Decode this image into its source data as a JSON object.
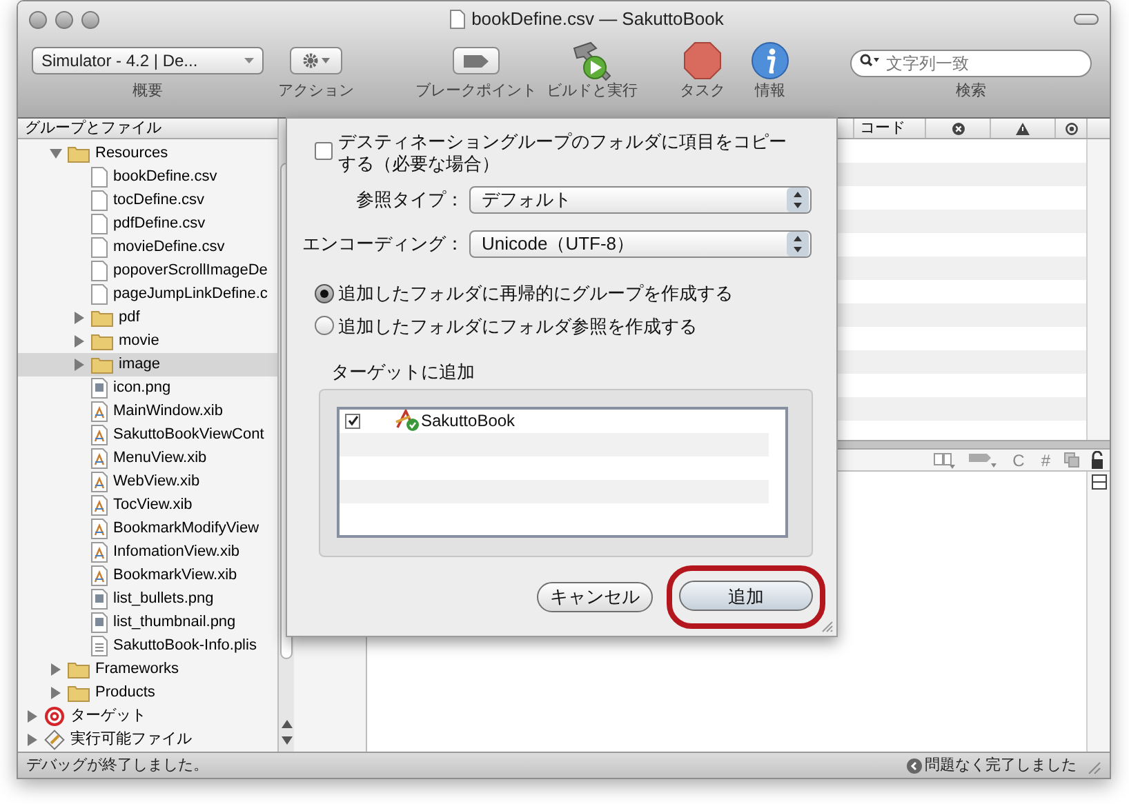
{
  "window": {
    "title": "bookDefine.csv — SakuttoBook"
  },
  "toolbar": {
    "scheme": {
      "value": "Simulator - 4.2 | De...",
      "label": "概要"
    },
    "items": [
      {
        "kind": "action",
        "label": "アクション"
      },
      {
        "kind": "breakpoints",
        "label": "ブレークポイント"
      },
      {
        "kind": "build",
        "label": "ビルドと実行"
      },
      {
        "kind": "tasks",
        "label": "タスク"
      },
      {
        "kind": "info",
        "label": "情報"
      }
    ],
    "search": {
      "placeholder": "文字列一致",
      "label": "検索"
    }
  },
  "sidebar": {
    "header": "グループとファイル",
    "project_items": [
      {
        "label": "Resources",
        "kind": "folder",
        "expanded": true,
        "selected": false,
        "children": [
          {
            "label": "bookDefine.csv",
            "kind": "file",
            "selected": false
          },
          {
            "label": "tocDefine.csv",
            "kind": "file",
            "selected": false
          },
          {
            "label": "pdfDefine.csv",
            "kind": "file",
            "selected": false
          },
          {
            "label": "movieDefine.csv",
            "kind": "file",
            "selected": false
          },
          {
            "label": "popoverScrollImageDe",
            "kind": "file",
            "selected": false
          },
          {
            "label": "pageJumpLinkDefine.c",
            "kind": "file",
            "selected": false
          },
          {
            "label": "pdf",
            "kind": "folder",
            "expanded": false,
            "selected": false
          },
          {
            "label": "movie",
            "kind": "folder",
            "expanded": false,
            "selected": false
          },
          {
            "label": "image",
            "kind": "folder",
            "expanded": false,
            "selected": true
          },
          {
            "label": "icon.png",
            "kind": "image",
            "selected": false
          },
          {
            "label": "MainWindow.xib",
            "kind": "xib",
            "selected": false
          },
          {
            "label": "SakuttoBookViewCont",
            "kind": "xib",
            "selected": false
          },
          {
            "label": "MenuView.xib",
            "kind": "xib",
            "selected": false
          },
          {
            "label": "WebView.xib",
            "kind": "xib",
            "selected": false
          },
          {
            "label": "TocView.xib",
            "kind": "xib",
            "selected": false
          },
          {
            "label": "BookmarkModifyView",
            "kind": "xib",
            "selected": false
          },
          {
            "label": "InfomationView.xib",
            "kind": "xib",
            "selected": false
          },
          {
            "label": "BookmarkView.xib",
            "kind": "xib",
            "selected": false
          },
          {
            "label": "list_bullets.png",
            "kind": "image",
            "selected": false
          },
          {
            "label": "list_thumbnail.png",
            "kind": "image",
            "selected": false
          },
          {
            "label": "SakuttoBook-Info.plis",
            "kind": "plist",
            "selected": false
          }
        ]
      },
      {
        "label": "Frameworks",
        "kind": "folder",
        "expanded": false,
        "selected": false
      },
      {
        "label": "Products",
        "kind": "folder",
        "expanded": false,
        "selected": false
      }
    ],
    "root_items": [
      {
        "label": "ターゲット",
        "kind": "target",
        "expanded": false,
        "selected": false
      },
      {
        "label": "実行可能ファイル",
        "kind": "executable",
        "expanded": false,
        "selected": false
      }
    ]
  },
  "editor": {
    "columns": [
      {
        "kind": "text",
        "label": "コード"
      },
      {
        "kind": "errors"
      },
      {
        "kind": "warnings"
      },
      {
        "kind": "status"
      }
    ],
    "toolbar": [
      {
        "kind": "bookmark"
      },
      {
        "kind": "tag"
      },
      {
        "kind": "text",
        "label": "C"
      },
      {
        "kind": "text",
        "label": "#"
      },
      {
        "kind": "counterpart"
      }
    ]
  },
  "dialog": {
    "copy_items": {
      "label": "デスティネーショングループのフォルダに項目をコピーする（必要な場合）",
      "checked": false
    },
    "reference_type": {
      "label": "参照タイプ：",
      "value": "デフォルト"
    },
    "encoding": {
      "label": "エンコーディング：",
      "value": "Unicode（UTF-8）"
    },
    "folder_options": [
      {
        "label": "追加したフォルダに再帰的にグループを作成する",
        "selected": true
      },
      {
        "label": "追加したフォルダにフォルダ参照を作成する",
        "selected": false
      }
    ],
    "targets": {
      "label": "ターゲットに追加",
      "items": [
        {
          "name": "SakuttoBook",
          "checked": true
        }
      ]
    },
    "buttons": [
      {
        "label": "キャンセル",
        "default": false,
        "highlighted": false
      },
      {
        "label": "追加",
        "default": true,
        "highlighted": true
      }
    ]
  },
  "status_bar": {
    "left": "デバッグが終了しました。",
    "right": "問題なく完了しました"
  }
}
